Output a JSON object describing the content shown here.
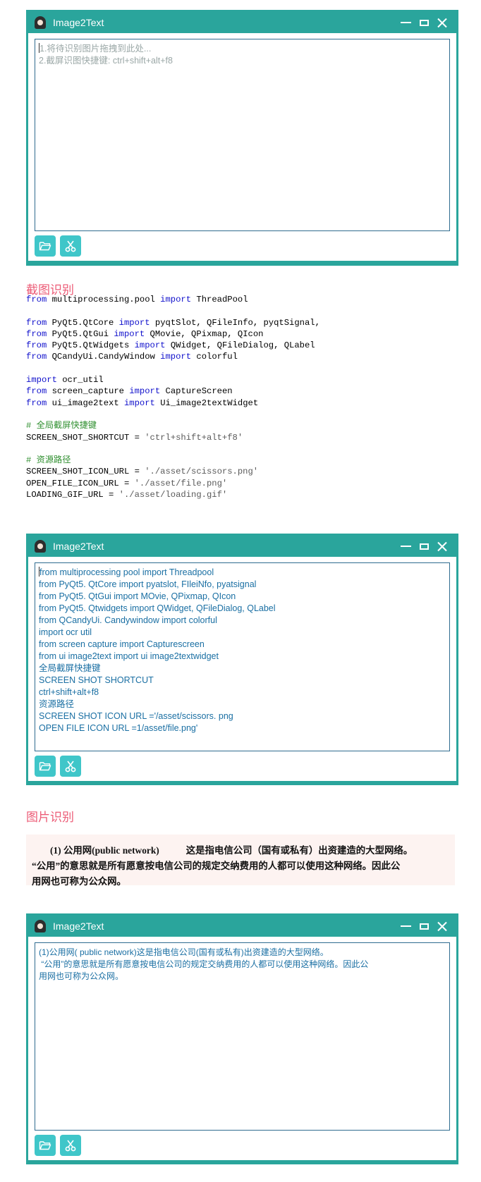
{
  "app": {
    "title": "Image2Text"
  },
  "windows": [
    {
      "lines": [
        "1.将待识别图片拖拽到此处...",
        "2.截屏识图快捷键: ctrl+shift+alt+f8"
      ]
    },
    {
      "lines": [
        "from multiprocessing pool import Threadpool",
        "from PyQt5. QtCore import pyatslot, FIleiNfo, pyatsignal",
        "from PyQt5. QtGui import MOvie, QPixmap, QIcon",
        "from PyQt5. Qtwidgets import QWidget, QFileDialog, QLabel",
        "from QCandyUi. Candywindow import colorful",
        "import ocr util",
        "from screen capture import Capturescreen",
        "from ui image2text import ui image2textwidget",
        "全局截屏快捷键",
        "SCREEN SHOT SHORTCUT",
        "ctrl+shift+alt+f8",
        "资源路径",
        "SCREEN SHOT ICON URL ='/asset/scissors. png",
        "OPEN FILE ICON URL =1/asset/file.png'"
      ]
    },
    {
      "lines": [
        "(1)公用网( public network)这是指电信公司(国有或私有)出资建造的大型网络。",
        " “公用”的意思就是所有愿意按电信公司的规定交纳费用的人都可以使用这种网络。因此公",
        "用网也可称为公众网。"
      ]
    }
  ],
  "sections": {
    "screenshot": "截图识别",
    "image": "图片识别"
  },
  "code": {
    "l1": {
      "kw1": "from",
      "t1": " multiprocessing.pool ",
      "kw2": "import",
      "t2": " ThreadPool"
    },
    "l2": {
      "kw1": "from",
      "t1": " PyQt5.QtCore ",
      "kw2": "import",
      "t2": " pyqtSlot, QFileInfo, pyqtSignal,"
    },
    "l3": {
      "kw1": "from",
      "t1": " PyQt5.QtGui ",
      "kw2": "import",
      "t2": " QMovie, QPixmap, QIcon"
    },
    "l4": {
      "kw1": "from",
      "t1": " PyQt5.QtWidgets ",
      "kw2": "import",
      "t2": " QWidget, QFileDialog, QLabel"
    },
    "l5": {
      "kw1": "from",
      "t1": " QCandyUi.CandyWindow ",
      "kw2": "import",
      "t2": " colorful"
    },
    "l6": {
      "kw1": "import",
      "t1": " ocr_util"
    },
    "l7": {
      "kw1": "from",
      "t1": " screen_capture ",
      "kw2": "import",
      "t2": " CaptureScreen"
    },
    "l8": {
      "kw1": "from",
      "t1": " ui_image2text ",
      "kw2": "import",
      "t2": " Ui_image2textWidget"
    },
    "c1": "# 全局截屏快捷键",
    "l9": {
      "t1": "SCREEN_SHOT_SHORTCUT = ",
      "s": "'ctrl+shift+alt+f8'"
    },
    "c2": "# 资源路径",
    "l10": {
      "t1": "SCREEN_SHOT_ICON_URL = ",
      "s": "'./asset/scissors.png'"
    },
    "l11": {
      "t1": "OPEN_FILE_ICON_URL = ",
      "s": "'./asset/file.png'"
    },
    "l12": {
      "t1": "LOADING_GIF_URL = ",
      "s": "'./asset/loading.gif'"
    }
  },
  "paper": {
    "num": "(1)",
    "term": "公用网(public network)",
    "rest": "这是指电信公司（国有或私有）出资建造的大型网络。",
    "line2": "“公用”的意思就是所有愿意按电信公司的规定交纳费用的人都可以使用这种网络。因此公",
    "line3a": "用网也可称为",
    "line3b": "公众网",
    "line3c": "。"
  },
  "icons": {
    "open": "folder-open-icon",
    "cut": "scissors-icon"
  },
  "colors": {
    "accent": "#2aa59c",
    "button": "#3fc6c9",
    "section_title": "#ec5b76"
  }
}
